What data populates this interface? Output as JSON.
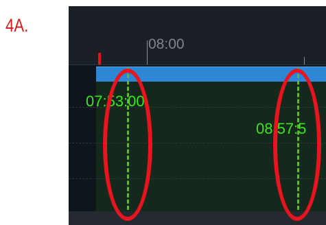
{
  "annotation": {
    "step_label": "4A.",
    "accent_color": "#e8141e"
  },
  "timeline": {
    "ruler_tick_label": "08:00",
    "range_start_time": "07:53:00",
    "range_end_time_visible": "08:57:5",
    "range_bar_color": "#2e87d4",
    "marker_color": "#5dbb2a",
    "time_text_color": "#37e81a",
    "playhead_color": "#e0141c"
  }
}
